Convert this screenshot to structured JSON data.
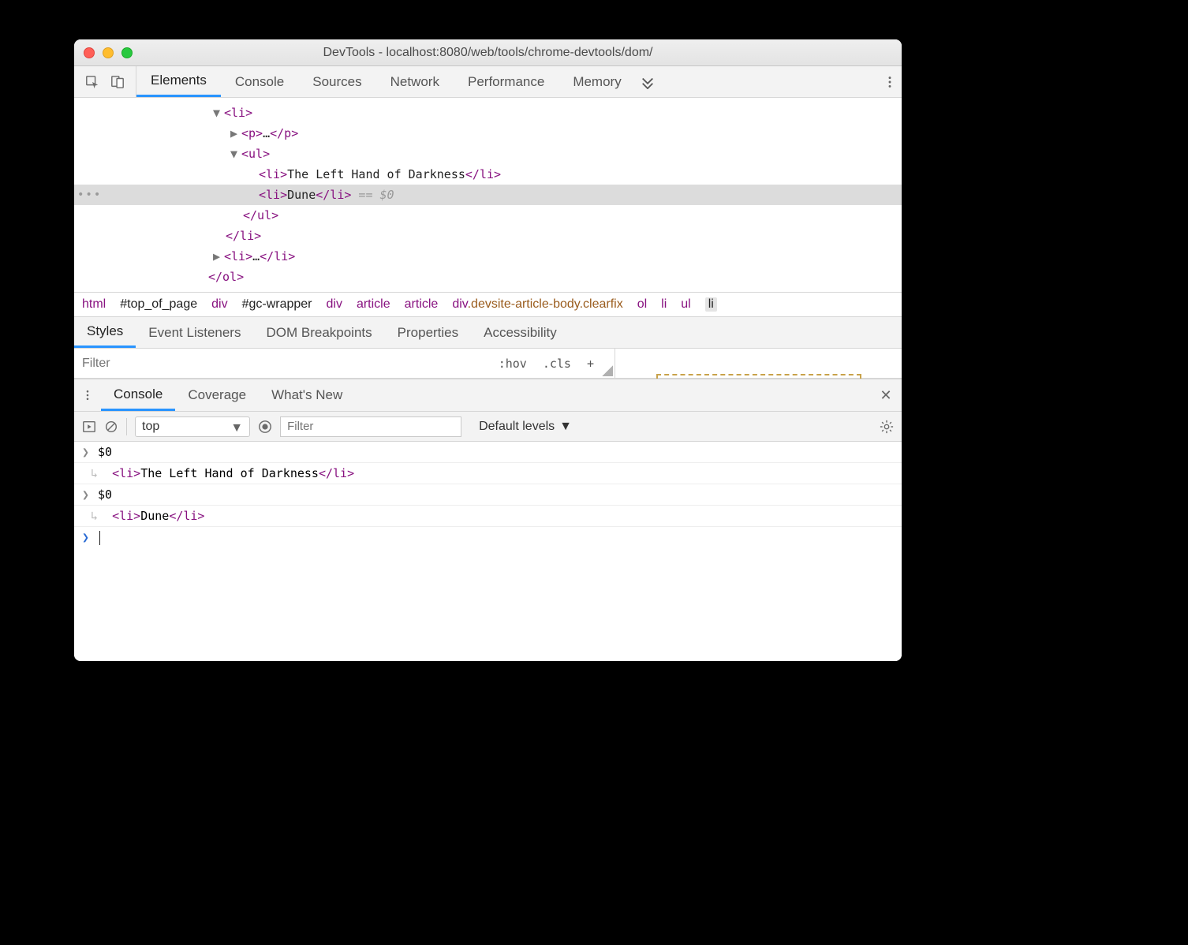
{
  "window": {
    "title": "DevTools - localhost:8080/web/tools/chrome-devtools/dom/"
  },
  "mainTabs": [
    "Elements",
    "Console",
    "Sources",
    "Network",
    "Performance",
    "Memory"
  ],
  "mainTabActive": 0,
  "domTree": {
    "line1": {
      "arrow": "▼",
      "tag_open": "<li>"
    },
    "line2": {
      "arrow": "▶",
      "tag_open": "<p>",
      "ellipsis": "…",
      "tag_close": "</p>"
    },
    "line3": {
      "arrow": "▼",
      "tag_open": "<ul>"
    },
    "line4": {
      "tag_open": "<li>",
      "text": "The Left Hand of Darkness",
      "tag_close": "</li>"
    },
    "line5": {
      "tag_open": "<li>",
      "text": "Dune",
      "tag_close": "</li>",
      "extra": " == $0"
    },
    "line6": {
      "tag_close": "</ul>"
    },
    "line7": {
      "tag_close": "</li>"
    },
    "line8": {
      "arrow": "▶",
      "tag_open": "<li>",
      "ellipsis": "…",
      "tag_close": "</li>"
    },
    "line9": {
      "tag_close": "</ol>"
    }
  },
  "breadcrumbs": [
    {
      "text": "html",
      "kind": "tag"
    },
    {
      "text": "#top_of_page",
      "kind": "id"
    },
    {
      "text": "div",
      "kind": "tag"
    },
    {
      "text": "#gc-wrapper",
      "kind": "id"
    },
    {
      "text": "div",
      "kind": "tag"
    },
    {
      "text": "article",
      "kind": "tag"
    },
    {
      "text": "article",
      "kind": "tag"
    },
    {
      "text": "div.devsite-article-body.clearfix",
      "kind": "cls"
    },
    {
      "text": "ol",
      "kind": "tag"
    },
    {
      "text": "li",
      "kind": "tag"
    },
    {
      "text": "ul",
      "kind": "tag"
    },
    {
      "text": "li",
      "kind": "sel"
    }
  ],
  "subTabs": [
    "Styles",
    "Event Listeners",
    "DOM Breakpoints",
    "Properties",
    "Accessibility"
  ],
  "subTabActive": 0,
  "stylesFilter": {
    "placeholder": "Filter",
    "hov": ":hov",
    "cls": ".cls",
    "plus": "+"
  },
  "drawerTabs": [
    "Console",
    "Coverage",
    "What's New"
  ],
  "drawerTabActive": 0,
  "consoleCtrl": {
    "context": "top",
    "filterPlaceholder": "Filter",
    "levels": "Default levels"
  },
  "consoleLines": [
    {
      "gutter": ">",
      "type": "in",
      "text": "$0"
    },
    {
      "gutter": "↩",
      "type": "out",
      "pre": "  ",
      "tag_open": "<li>",
      "text": "The Left Hand of Darkness",
      "tag_close": "</li>"
    },
    {
      "gutter": ">",
      "type": "in",
      "text": "$0"
    },
    {
      "gutter": "↩",
      "type": "out",
      "pre": "  ",
      "tag_open": "<li>",
      "text": "Dune",
      "tag_close": "</li>"
    },
    {
      "gutter": ">",
      "type": "prompt",
      "text": ""
    }
  ]
}
